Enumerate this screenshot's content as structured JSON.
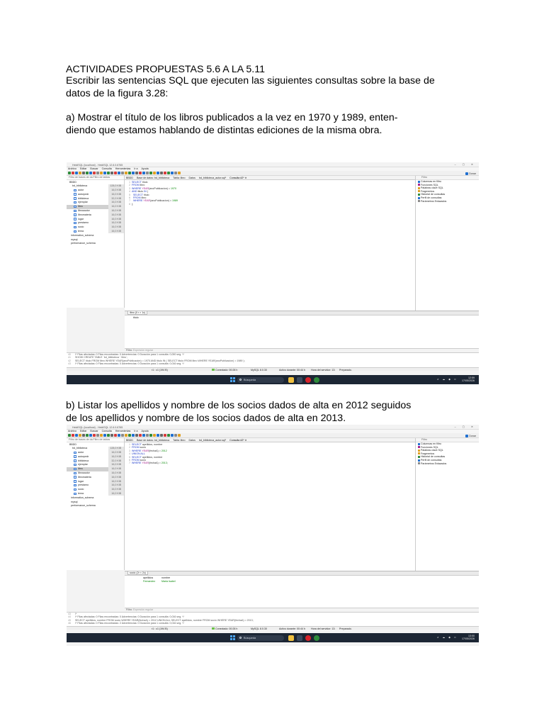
{
  "heading": "ACTIVIDADES PROPUESTAS 5.6 A LA 5.11",
  "intro": [
    "Escribir las sentencias SQL que ejecuten las siguientes consultas sobre la base de",
    "datos de la figura 3.28:"
  ],
  "question_a": [
    "a) Mostrar el título de los libros publicados a la vez en 1970 y 1989, enten-",
    "diendo que estamos hablando de distintas ediciones de la misma obra."
  ],
  "question_b": [
    "b) Listar los apellidos y nombre de los socios dados de alta en 2012 seguidos",
    "de los apellidos y nombre de los socios dados de alta en 2013."
  ],
  "app": {
    "window_title": "HeidiSQL (localhost) - HeidiSQL 12.6.0.6765",
    "window_controls": "– ▢ ✕",
    "menu": [
      "Archivo",
      "Editar",
      "Buscar",
      "Consulta",
      "Herramientas",
      "Ir a",
      "Ayuda"
    ],
    "toolbar_right": "Donar",
    "nav_search": "Filtro de bases de da   Filtro de tablas",
    "nav_root": "BBDD",
    "nav_db": "bd_biblioteca",
    "nav_db_size": "128,0 KiB",
    "tables": [
      {
        "name": "autor",
        "size": "16,0 KiB"
      },
      {
        "name": "autorpedr",
        "size": "16,0 KiB"
      },
      {
        "name": "biblioteca",
        "size": "32,0 KiB"
      },
      {
        "name": "ejemplar",
        "size": "16,0 KiB"
      },
      {
        "name": "libro",
        "size": "16,0 KiB"
      },
      {
        "name": "librosautor",
        "size": "16,0 KiB"
      },
      {
        "name": "libromateria",
        "size": "16,0 KiB"
      },
      {
        "name": "lugar",
        "size": "16,0 KiB"
      },
      {
        "name": "prestamo",
        "size": "16,0 KiB"
      },
      {
        "name": "socio",
        "size": "16,0 KiB"
      },
      {
        "name": "tema",
        "size": "16,0 KiB"
      }
    ],
    "other_dbs": [
      "information_schema",
      "mysql",
      "performance_schema"
    ],
    "editor_tabs": [
      "BBDD",
      "Base de datos: bd_biblioteca",
      "Tabla: libro",
      "Datos",
      "bd_biblioteca_autor.sql*",
      "Consulta #2* ✕"
    ],
    "right_header": "Filtro",
    "right_items": [
      "Columnas en filtro",
      "Funciones SQL",
      "Palabras clave SQL",
      "Fragmentos",
      "Historial de consultas",
      "Perfil de consultas",
      "Parámetros Enlazados"
    ],
    "filter_label": "Filtro:",
    "filter_placeholder": "Expresión regular",
    "status": [
      "r1 : c1 (194 B)",
      "Conectado: 00:28 h",
      "MySQL 8.0.30",
      "Activo durante: 00:44 h",
      "Hora del servidor: 13:",
      "Preparado."
    ],
    "taskbar_search": "Búsqueda",
    "tray_icons": "∧ ☁ ◆ ⊂",
    "tray_time": "12:59",
    "tray_date": "17/05/2026",
    "tray_time2": "13:00"
  },
  "shot1": {
    "code": [
      "SELECT titulo",
      "FROM libro",
      "WHERE YEAR(anoPublicacion) = 1970",
      "AND titulo IN (",
      "  SELECT titulo",
      "  FROM libro",
      "  WHERE YEAR(anoPublicacion) = 1989",
      ");"
    ],
    "result_tab": "libro (0 r × 1c)",
    "result_col": "titulo",
    "log": [
      "/* Filas afectadas: 0  Filas encontradas: 0  Advertencias: 0  Duración para 1 consulta: 0,000 seg. */",
      "SHOW CREATE TABLE `bd_biblioteca`.`libro`;",
      "SELECT titulo FROM libro WHERE YEAR(anoPublicacion) = 1970 AND titulo IN ( SELECT titulo FROM libro WHERE YEAR(anoPublicacion) = 1989 );",
      "/* Filas afectadas: 0  Filas encontradas: 0  Advertencias: 0  Duración para 1 consulta: 0,016 seg. */"
    ],
    "log_numbers": [
      "40",
      "41",
      "42",
      "43"
    ]
  },
  "shot2": {
    "code": [
      "SELECT apellidos, nombre",
      "FROM socio",
      "WHERE YEAR(fechaA) = 2012",
      "UNION ALL",
      "SELECT apellidos, nombre",
      "FROM socio",
      "WHERE YEAR(fechaA) = 2013;"
    ],
    "result_tab": "socio (2r × 2c)",
    "result_cols": [
      "apellidos",
      "nombre"
    ],
    "result_row": [
      "Fernandez",
      "Maria Isabel"
    ],
    "log": [
      "/*",
      "/* Filas afectadas: 0  Filas encontradas: 0  Advertencias: 0  Duración para 1 consulta: 0,016 seg. */",
      "SELECT apellidos, nombre FROM socio WHERE YEAR(fechaA) = 2012 UNION ALL SELECT apellidos, nombre FROM socio WHERE YEAR(fechaA) = 2013;",
      "/* Filas afectadas: 0  Filas encontradas: 2  Advertencias: 0  Duración para 1 consulta: 0,016 seg. */"
    ],
    "log_numbers": [
      "43",
      "44",
      "45",
      "46"
    ]
  }
}
